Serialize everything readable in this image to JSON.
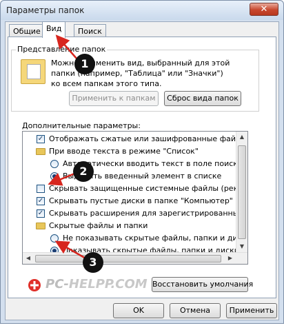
{
  "window": {
    "title": "Параметры папок",
    "close_glyph": "✕"
  },
  "tabs": [
    {
      "label": "Общие",
      "active": false
    },
    {
      "label": "Вид",
      "active": true
    },
    {
      "label": "Поиск",
      "active": false
    }
  ],
  "folder_view": {
    "label": "Представление папок",
    "description_lines": [
      "Можно применить вид, выбранный для этой",
      "папки (например, \"Таблица\" или \"Значки\")",
      "ко всем папкам этого типа."
    ],
    "apply_button": "Применить к папкам",
    "reset_button": "Сброс вида папок"
  },
  "advanced": {
    "label": "Дополнительные параметры:",
    "items": [
      {
        "type": "checkbox",
        "checked": true,
        "indent": 0,
        "text": "Отображать сжатые или зашифрованные файлы NTI"
      },
      {
        "type": "folder",
        "indent": 0,
        "text": "При вводе текста в режиме \"Список\""
      },
      {
        "type": "radio",
        "checked": false,
        "indent": 1,
        "text": "Автоматически вводить текст в поле поиска"
      },
      {
        "type": "radio",
        "checked": true,
        "indent": 1,
        "text": "Выделять введенный элемент в списке"
      },
      {
        "type": "checkbox",
        "checked": false,
        "indent": 0,
        "text": "Скрывать защищенные системные файлы (рекомен"
      },
      {
        "type": "checkbox",
        "checked": true,
        "indent": 0,
        "text": "Скрывать пустые диски в папке \"Компьютер\""
      },
      {
        "type": "checkbox",
        "checked": true,
        "indent": 0,
        "text": "Скрывать расширения для зарегистрированных типо"
      },
      {
        "type": "folder",
        "indent": 0,
        "text": "Скрытые файлы и папки"
      },
      {
        "type": "radio",
        "checked": false,
        "indent": 1,
        "text": "Не показывать скрытые файлы, папки и диски"
      },
      {
        "type": "radio",
        "checked": true,
        "indent": 1,
        "text": "Показывать скрытые файлы, папки и диски"
      }
    ],
    "check_glyph": "✓",
    "scroll_up_glyph": "▲",
    "scroll_down_glyph": "▼",
    "scroll_left_glyph": "◀",
    "scroll_right_glyph": "▶"
  },
  "restore_button": "Восстановить умолчания",
  "dialog_buttons": {
    "ok": "OK",
    "cancel": "Отмена",
    "apply": "Применить"
  },
  "callouts": [
    "1",
    "2",
    "3"
  ],
  "watermark": {
    "text": "PC-HELPP.COM",
    "color": "#e0302a"
  },
  "colors": {
    "accent_red": "#d7261e",
    "window_frame": "#d3dfee",
    "close_button": "#c7472e"
  }
}
